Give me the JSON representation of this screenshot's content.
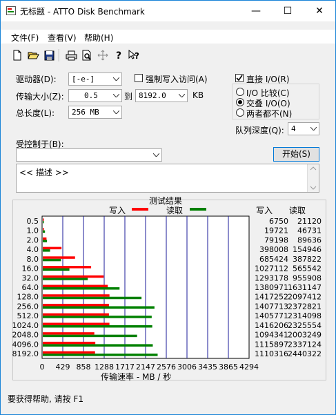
{
  "window": {
    "title": "无标题 - ATTO Disk Benchmark",
    "minimize": "—",
    "maximize": "☐",
    "close": "✕"
  },
  "menu": [
    "文件(F)",
    "查看(V)",
    "帮助(H)"
  ],
  "toolbar": {
    "icons": [
      "new-file-icon",
      "open-folder-icon",
      "save-icon",
      "print-icon",
      "print-preview-icon",
      "move-icon",
      "help-icon",
      "context-help-icon"
    ]
  },
  "settings": {
    "drive_label": "驱动器(D):",
    "drive_value": "[-e-]",
    "force_write_label": "强制写入访问(A)",
    "force_write": false,
    "direct_io_label": "直接 I/O(R)",
    "direct_io": true,
    "transfer_label": "传输大小(Z):",
    "transfer_from": "0.5",
    "to_label": "到",
    "transfer_to": "8192.0",
    "kb": "KB",
    "length_label": "总长度(L):",
    "length_value": "256 MB",
    "io_compare": "I/O 比较(C)",
    "overlapped": "交叠 I/O(O)",
    "neither": "两者都不(N)",
    "selected_mode": "overlapped",
    "queue_label": "队列深度(Q):",
    "queue_value": "4",
    "controlled_label": "受控制于(B):",
    "controlled_value": "",
    "start_button": "开始(S)",
    "description": "<< 描述 >>"
  },
  "results": {
    "title": "测试结果",
    "write_label": "写入",
    "read_label": "读取",
    "col_write": "写入",
    "col_read": "读取",
    "xlabel": "传输速率 - MB / 秒",
    "write_color": "#ff0000",
    "read_color": "#008000"
  },
  "chart_data": {
    "type": "bar",
    "orientation": "horizontal",
    "categories": [
      "0.5",
      "1.0",
      "2.0",
      "4.0",
      "8.0",
      "16.0",
      "32.0",
      "64.0",
      "128.0",
      "256.0",
      "512.0",
      "1024.0",
      "2048.0",
      "4096.0",
      "8192.0"
    ],
    "series": [
      {
        "name": "写入",
        "values": [
          6750,
          19721,
          79198,
          398008,
          685424,
          1027112,
          1293178,
          1380971,
          1417252,
          1407713,
          1405771,
          1416206,
          1094341,
          1115897,
          1110316
        ]
      },
      {
        "name": "读取",
        "values": [
          21120,
          46731,
          89636,
          154946,
          387822,
          565542,
          955908,
          1631147,
          2097412,
          2372821,
          2314098,
          2325554,
          2003249,
          2337124,
          2440322
        ]
      }
    ],
    "unit_divisor": 1024,
    "xticks": [
      "0",
      "429",
      "858",
      "1288",
      "1717",
      "2147",
      "2576",
      "3006",
      "3435",
      "3865",
      "4294"
    ],
    "xlim": [
      0,
      4294
    ],
    "xlabel": "传输速率 - MB / 秒",
    "grid": true
  },
  "status": {
    "text": "要获得帮助, 请按 F1"
  }
}
